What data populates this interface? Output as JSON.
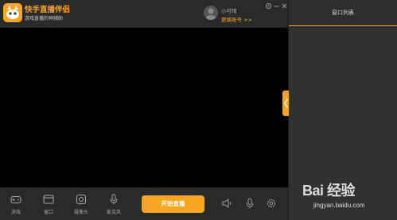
{
  "app": {
    "title": "快手直播伴侣",
    "subtitle": "游戏直播的神辅助"
  },
  "user": {
    "name": "小可晴",
    "switch_account": "更换账号 >>"
  },
  "window_controls": {
    "settings_icon": "gear-icon",
    "minimize_icon": "minus-icon",
    "close_icon": "close-icon"
  },
  "toolbar": {
    "items": [
      {
        "label": "游戏",
        "icon": "gamepad-icon"
      },
      {
        "label": "窗口",
        "icon": "window-icon"
      },
      {
        "label": "摄像头",
        "icon": "camera-icon"
      },
      {
        "label": "麦克风",
        "icon": "microphone-icon"
      }
    ],
    "start_button": "开始直播",
    "controls": [
      "speaker-icon",
      "microphone-icon",
      "gear-icon"
    ]
  },
  "side_panel": {
    "title": "窗口列表"
  },
  "watermark": {
    "logo": "Bai 经验",
    "url": "jingyan.baidu.com"
  },
  "colors": {
    "accent": "#f6a623",
    "preview": "#000000",
    "panel": "#2d2d2d"
  }
}
